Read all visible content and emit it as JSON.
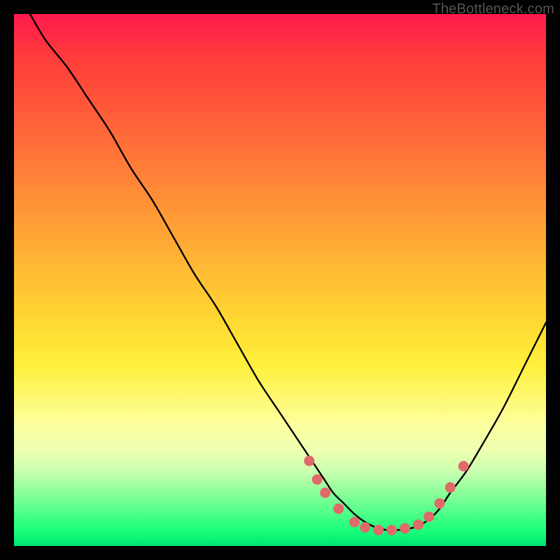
{
  "watermark": "TheBottleneck.com",
  "colors": {
    "background": "#000000",
    "curve": "#000000",
    "dot_fill": "#e06a6a",
    "dot_stroke": "#c94f4f"
  },
  "chart_data": {
    "type": "line",
    "title": "",
    "xlabel": "",
    "ylabel": "",
    "xlim": [
      0,
      100
    ],
    "ylim": [
      0,
      100
    ],
    "series": [
      {
        "name": "bottleneck-curve",
        "x": [
          0,
          3,
          6,
          10,
          14,
          18,
          22,
          26,
          30,
          34,
          38,
          42,
          46,
          50,
          54,
          58,
          60,
          62,
          64,
          66,
          68,
          70,
          72,
          74,
          76,
          78,
          80,
          82,
          85,
          88,
          92,
          96,
          100
        ],
        "y": [
          105,
          100,
          95,
          90,
          84,
          78,
          71,
          65,
          58,
          51,
          45,
          38,
          31,
          25,
          19,
          13,
          10,
          8,
          6,
          4.5,
          3.5,
          3,
          3,
          3.2,
          3.8,
          5,
          7,
          10,
          14,
          19,
          26,
          34,
          42
        ]
      }
    ],
    "dots": [
      {
        "x": 55.5,
        "y": 16
      },
      {
        "x": 57.0,
        "y": 12.5
      },
      {
        "x": 58.5,
        "y": 10
      },
      {
        "x": 61.0,
        "y": 7
      },
      {
        "x": 64.0,
        "y": 4.5
      },
      {
        "x": 66.0,
        "y": 3.5
      },
      {
        "x": 68.5,
        "y": 3
      },
      {
        "x": 71.0,
        "y": 3
      },
      {
        "x": 73.5,
        "y": 3.3
      },
      {
        "x": 76.0,
        "y": 4
      },
      {
        "x": 78.0,
        "y": 5.5
      },
      {
        "x": 80.0,
        "y": 8
      },
      {
        "x": 82.0,
        "y": 11
      },
      {
        "x": 84.5,
        "y": 15
      }
    ]
  }
}
